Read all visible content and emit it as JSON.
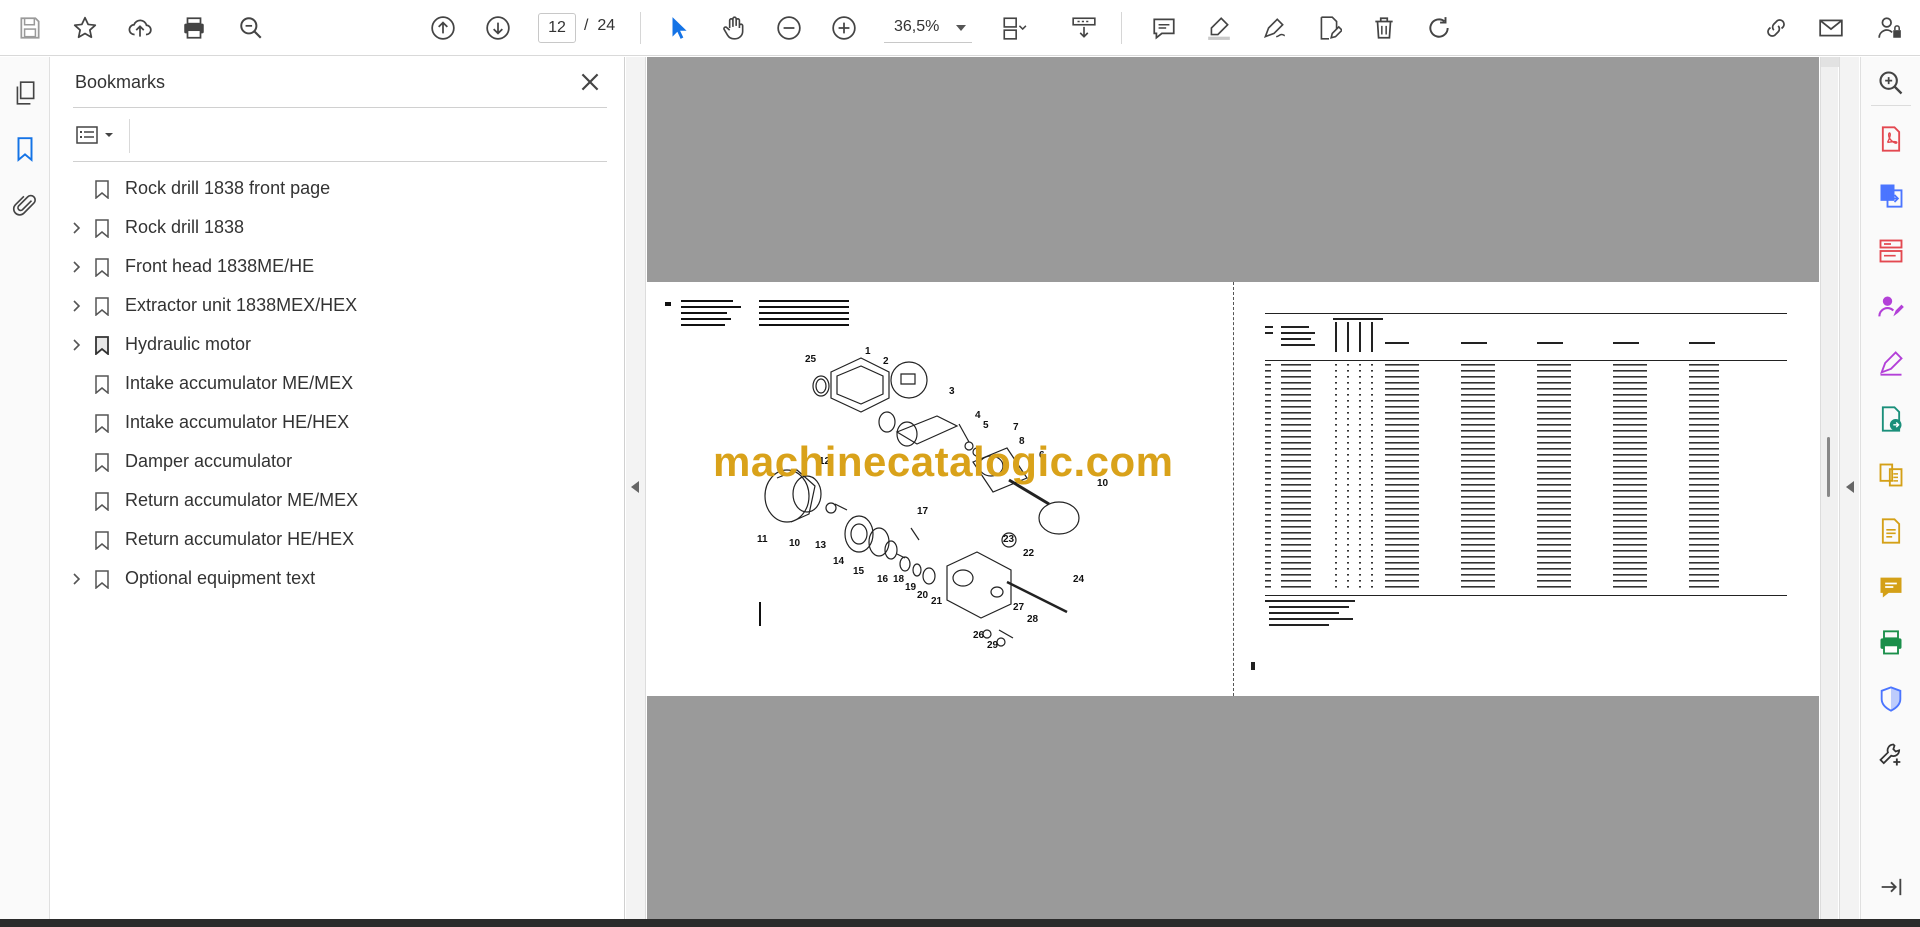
{
  "toolbar": {
    "current_page": "12",
    "page_separator": "/",
    "total_pages": "24",
    "zoom": "36,5%"
  },
  "bookmarks": {
    "title": "Bookmarks",
    "items": [
      {
        "label": "Rock drill 1838 front page",
        "expandable": false
      },
      {
        "label": "Rock drill 1838",
        "expandable": true
      },
      {
        "label": "Front head 1838ME/HE",
        "expandable": true
      },
      {
        "label": "Extractor unit 1838MEX/HEX",
        "expandable": true
      },
      {
        "label": "Hydraulic motor",
        "expandable": true
      },
      {
        "label": "Intake accumulator ME/MEX",
        "expandable": false
      },
      {
        "label": "Intake accumulator HE/HEX",
        "expandable": false
      },
      {
        "label": "Damper accumulator",
        "expandable": false
      },
      {
        "label": "Return accumulator ME/MEX",
        "expandable": false
      },
      {
        "label": "Return accumulator HE/HEX",
        "expandable": false
      },
      {
        "label": "Optional equipment text",
        "expandable": true
      }
    ]
  },
  "document": {
    "watermark": "machinecatalogic.com"
  },
  "colors": {
    "accent": "#1473e6",
    "doc_background": "#9a9a9a",
    "watermark": "#d9a21a",
    "right_rail_icons": [
      "#e34850",
      "#4b75ff",
      "#e34850",
      "#b340d8",
      "#b340d8",
      "#1a8f7a",
      "#d4a017",
      "#d4a017",
      "#d4a017",
      "#1a8f4a",
      "#4b75ff",
      "#333333"
    ]
  }
}
